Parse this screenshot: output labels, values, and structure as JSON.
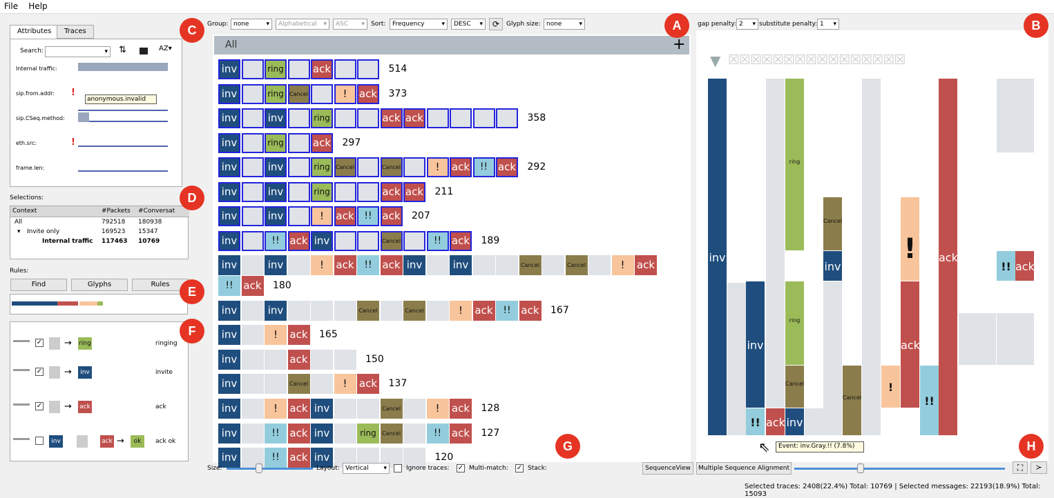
{
  "menu": {
    "file": "File",
    "help": "Help"
  },
  "left": {
    "tab_attributes": "Attributes",
    "tab_traces": "Traces",
    "search_label": "Search:",
    "attrs": [
      "Internal traffic:",
      "sip.from.addr:",
      "sip.CSeq.method:",
      "eth.src:",
      "frame.len:"
    ],
    "tooltip": "anonymous.invalid",
    "selections_label": "Selections:",
    "table_headers": [
      "Context",
      "#Packets",
      "#Conversat"
    ],
    "rows": [
      [
        "All",
        "792518",
        "180938"
      ],
      [
        "Invite only",
        "169523",
        "15347"
      ],
      [
        "Internal traffic",
        "117463",
        "10769"
      ]
    ],
    "rules_label": "Rules:",
    "find": "Find",
    "glyphs": "Glyphs",
    "rules": "Rules",
    "rule_items": [
      {
        "to": "ring",
        "name": "ringing"
      },
      {
        "to": "inv",
        "name": "invite"
      },
      {
        "to": "ack",
        "name": "ack"
      },
      {
        "to": "ok",
        "name": "ack ok"
      }
    ]
  },
  "toolbar": {
    "group_label": "Group:",
    "group": "none",
    "alpha": "Alphabetical",
    "asc": "ASC",
    "sort_label": "Sort:",
    "sort": "Frequency",
    "desc": "DESC",
    "glyph_label": "Glyph size:",
    "glyph": "none"
  },
  "seq_header": "All",
  "counts": [
    "514",
    "373",
    "358",
    "297",
    "292",
    "211",
    "207",
    "189",
    "180",
    "167",
    "165",
    "150",
    "137",
    "128",
    "127",
    "120"
  ],
  "msa": {
    "gap_label": "gap penalty:",
    "gap": "2",
    "sub_label": "substitute penalty:",
    "sub": "1",
    "tooltip": "Event: inv.Gray.!! (7.8%)"
  },
  "bottom": {
    "size": "Size:",
    "layout_label": "Layout:",
    "layout": "Vertical",
    "ignore": "Ignore traces:",
    "multi": "Multi-match:",
    "stack": "Stack:",
    "seqview": "SequenceView",
    "msa_btn": "Multiple Sequence Alignment"
  },
  "status": "Selected traces: 2408(22.4%) Total: 10769 | Selected messages: 22193(18.9%) Total: 15093",
  "glyph_text": {
    "inv": "inv",
    "ring": "ring",
    "ack": "ack",
    "cancel": "Cancel",
    "exc": "!",
    "ex2": "!!"
  },
  "badges": {
    "a": "A",
    "b": "B",
    "c": "C",
    "d": "D",
    "e": "E",
    "f": "F",
    "g": "G",
    "h": "H"
  }
}
